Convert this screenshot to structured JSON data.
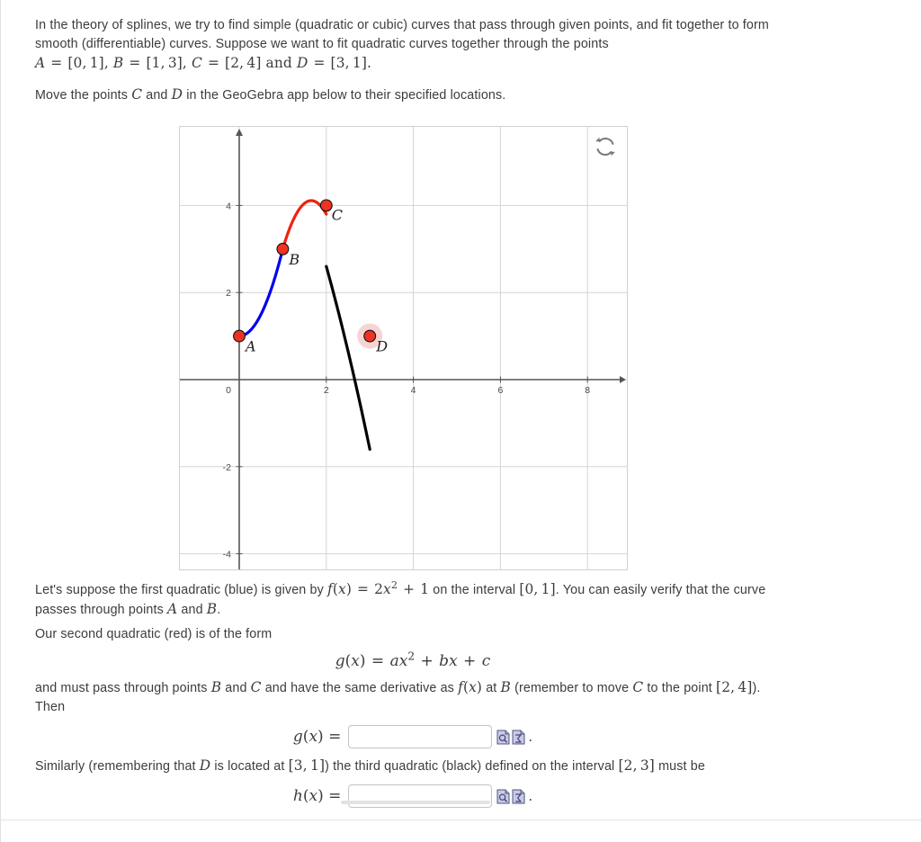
{
  "intro": {
    "line1": "In the theory of splines, we try to find simple (quadratic or cubic) curves that pass through given points, and fit",
    "line2": "together to form smooth (differentiable) curves. Suppose we want to fit quadratic curves together through the points",
    "points_math": "A = [0, 1], B = [1, 3], C = [2, 4] and D = [3, 1].",
    "instruction": "Move the points C and D in the GeoGebra app below to their specified locations.",
    "instruction_prefix": "Move the points ",
    "instruction_mid1": " and ",
    "instruction_suffix": " in the GeoGebra app below to their specified locations."
  },
  "applet": {
    "refresh_icon": "refresh-icon",
    "refresh_title": "Reset applet"
  },
  "body_text": {
    "p1_a": "Let's suppose the first quadratic (blue) is given by ",
    "p1_b": " on the interval ",
    "p1_c": ". You can easily verify that",
    "p1_d": "the curve passes through points ",
    "p1_e": " and ",
    "p1_f": ".",
    "p2": "Our second quadratic (red) is of the form",
    "p3_a": "and must pass through points ",
    "p3_b": " and ",
    "p3_c": " and have the same derivative as ",
    "p3_d": " at ",
    "p3_e": " (remember to move ",
    "p3_f": " to the",
    "p3_g": "point ",
    "p3_h": "). Then",
    "p4_a": "Similarly (remembering that ",
    "p4_b": " is located at ",
    "p4_c": ") the third quadratic (black) defined on the interval ",
    "p4_d": " must be"
  },
  "labels": {
    "A": "A",
    "B": "B",
    "C": "C",
    "D": "D",
    "f": "f",
    "g": "g",
    "h": "h",
    "x": "x",
    "a": "a",
    "b": "b",
    "c": "c",
    "interval_01": "[0, 1]",
    "interval_23": "[2, 3]",
    "point_24": "[2, 4]",
    "point_31": "[3, 1]",
    "fx_def": "f(x) = 2x² + 1",
    "gx_def": "g(x) = ax² + bx + c",
    "gx_lhs": "g(x) =",
    "hx_lhs": "h(x) ="
  },
  "answers": {
    "g_value": "",
    "g_placeholder": "",
    "h_value": "",
    "h_placeholder": "",
    "preview_icon": "preview-magnifier-icon",
    "mathmode_icon": "sigma-math-editor-icon",
    "trailing_punct": "."
  },
  "chart_data": {
    "type": "line",
    "title": "",
    "xlabel": "",
    "ylabel": "",
    "xlim": [
      -1.4,
      8.9
    ],
    "ylim": [
      -5.0,
      5.9
    ],
    "grid": true,
    "grid_step": 1,
    "x_ticks": [
      0,
      2,
      4,
      6,
      8
    ],
    "x_tick_labels": [
      "0",
      "2",
      "4",
      "6",
      "8"
    ],
    "y_ticks": [
      -4,
      -2,
      2,
      4
    ],
    "y_tick_labels": [
      "-4",
      "-2",
      "2",
      "4"
    ],
    "points": [
      {
        "name": "A",
        "x": 0,
        "y": 1,
        "color": "#ee3322",
        "selected": false
      },
      {
        "name": "B",
        "x": 1,
        "y": 3,
        "color": "#ee3322",
        "selected": false
      },
      {
        "name": "C",
        "x": 2,
        "y": 4,
        "color": "#ee3322",
        "selected": false
      },
      {
        "name": "D",
        "x": 3,
        "y": 1,
        "color": "#ee3322",
        "selected": true
      }
    ],
    "series": [
      {
        "name": "f(x) = 2x^2 + 1",
        "color": "#0000ee",
        "domain": [
          0,
          1
        ],
        "coeffs": [
          2,
          0,
          1
        ]
      },
      {
        "name": "g(x) (red quadratic)",
        "color": "#ee2211",
        "domain": [
          1,
          2
        ],
        "coeffs": [
          -2.6,
          8.6,
          -3.0
        ]
      },
      {
        "name": "h(x) (black quadratic)",
        "color": "#000000",
        "domain": [
          2,
          3
        ],
        "coeffs": [
          -0.6,
          -1.2,
          7.4
        ]
      }
    ]
  }
}
